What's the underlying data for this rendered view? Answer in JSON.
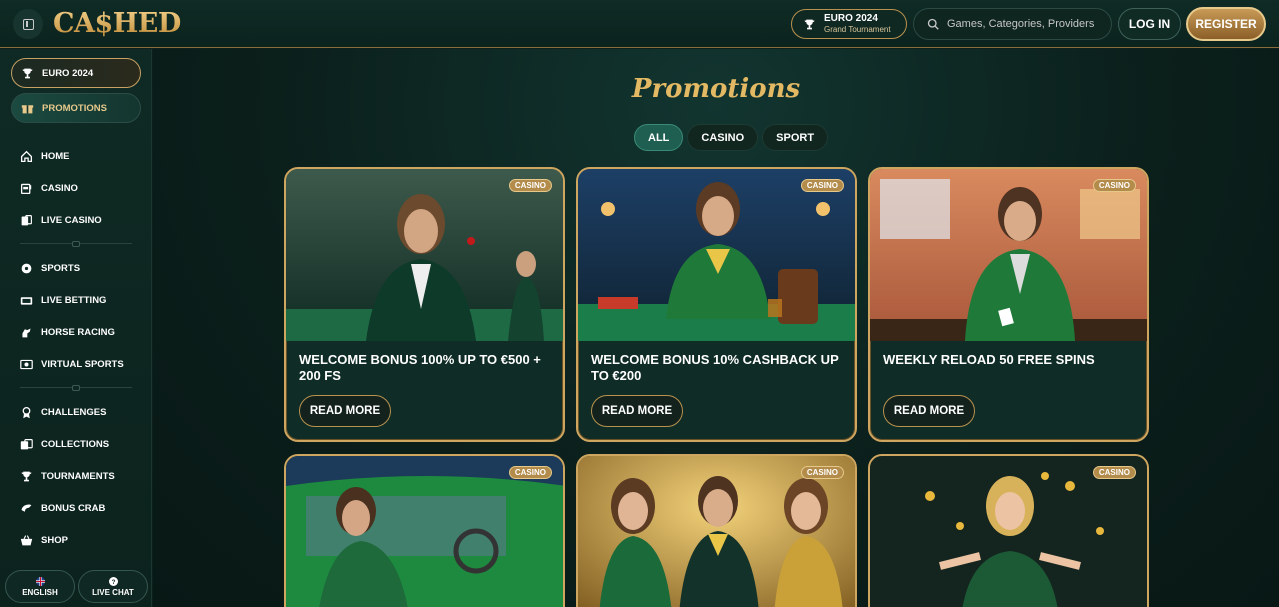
{
  "header": {
    "logo": "CA$HED",
    "tournament_title": "EURO 2024",
    "tournament_subtitle": "Grand Tournament",
    "search_placeholder": "Games, Categories, Providers",
    "login_label": "LOG IN",
    "register_label": "REGISTER"
  },
  "sidebar": {
    "top_pills": [
      {
        "label": "EURO 2024",
        "icon": "trophy-icon"
      },
      {
        "label": "PROMOTIONS",
        "icon": "gift-icon"
      }
    ],
    "group1": [
      {
        "label": "HOME",
        "icon": "home-icon"
      },
      {
        "label": "CASINO",
        "icon": "slot-machine-icon"
      },
      {
        "label": "LIVE CASINO",
        "icon": "cards-icon"
      }
    ],
    "group2": [
      {
        "label": "SPORTS",
        "icon": "ball-icon"
      },
      {
        "label": "LIVE BETTING",
        "icon": "live-icon"
      },
      {
        "label": "HORSE RACING",
        "icon": "horse-icon"
      },
      {
        "label": "VIRTUAL SPORTS",
        "icon": "virtual-icon"
      }
    ],
    "group3": [
      {
        "label": "CHALLENGES",
        "icon": "medal-icon"
      },
      {
        "label": "COLLECTIONS",
        "icon": "collection-icon"
      },
      {
        "label": "TOURNAMENTS",
        "icon": "trophy-icon"
      },
      {
        "label": "BONUS CRAB",
        "icon": "crab-icon"
      },
      {
        "label": "SHOP",
        "icon": "basket-icon"
      }
    ],
    "language_label": "ENGLISH",
    "live_chat_label": "LIVE CHAT"
  },
  "main": {
    "title": "Promotions",
    "filters": [
      {
        "label": "ALL",
        "active": true
      },
      {
        "label": "CASINO",
        "active": false
      },
      {
        "label": "SPORT",
        "active": false
      }
    ],
    "cards": [
      {
        "badge": "CASINO",
        "title": "WELCOME BONUS 100% UP TO €500 + 200 FS",
        "button": "READ MORE"
      },
      {
        "badge": "CASINO",
        "title": "WELCOME BONUS 10% CASHBACK UP TO €200",
        "button": "READ MORE"
      },
      {
        "badge": "CASINO",
        "title": "WEEKLY RELOAD 50 FREE SPINS",
        "button": "READ MORE"
      },
      {
        "badge": "CASINO",
        "title": "",
        "button": ""
      },
      {
        "badge": "CASINO",
        "title": "",
        "button": ""
      },
      {
        "badge": "CASINO",
        "title": "",
        "button": ""
      }
    ]
  },
  "colors": {
    "background": "#0b1f1b",
    "accent_gold": "#cfa660",
    "active_filter": "#1f5f51"
  }
}
